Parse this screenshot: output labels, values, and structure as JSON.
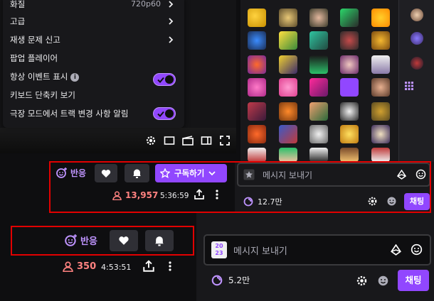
{
  "settings_menu": {
    "quality_label": "화질",
    "quality_value": "720p60",
    "advanced_label": "고급",
    "report_label": "재생 문제 신고",
    "popout_label": "팝업 플레이어",
    "always_events_label": "항상 이벤트 표시",
    "shortcuts_label": "키보드 단축키 보기",
    "theatre_alerts_label": "극장 모드에서 트랙 변경 사항 알림"
  },
  "top_bar": {
    "react_label": "반응",
    "subscribe_label": "구독하기",
    "viewers": "13,957",
    "uptime": "5:36:59"
  },
  "top_chat": {
    "placeholder": "메시지 보내기",
    "points": "12.7만",
    "chat_button": "채팅"
  },
  "bottom_bar": {
    "react_label": "반응",
    "viewers": "350",
    "uptime": "4:53:51"
  },
  "bottom_chat": {
    "placeholder": "메시지 보내기",
    "points": "5.2만",
    "chat_button": "채팅",
    "badge_line1": "20",
    "badge_line2": "23"
  },
  "colors": {
    "accent": "#9147ff",
    "accent_light": "#bf94ff",
    "viewer_red": "#ff8280",
    "highlight_red": "#e20000",
    "button_gray": "#2f2f35"
  },
  "icons": [
    "chevron-right-icon",
    "info-icon",
    "check-icon",
    "gear-icon",
    "miniplayer-icon",
    "clip-icon",
    "theatre-icon",
    "fullscreen-icon",
    "react-icon",
    "heart-icon",
    "bell-icon",
    "star-icon",
    "chevron-down-icon",
    "person-icon",
    "share-icon",
    "more-icon",
    "emote-icon",
    "bits-icon",
    "smile-icon",
    "points-icon"
  ]
}
